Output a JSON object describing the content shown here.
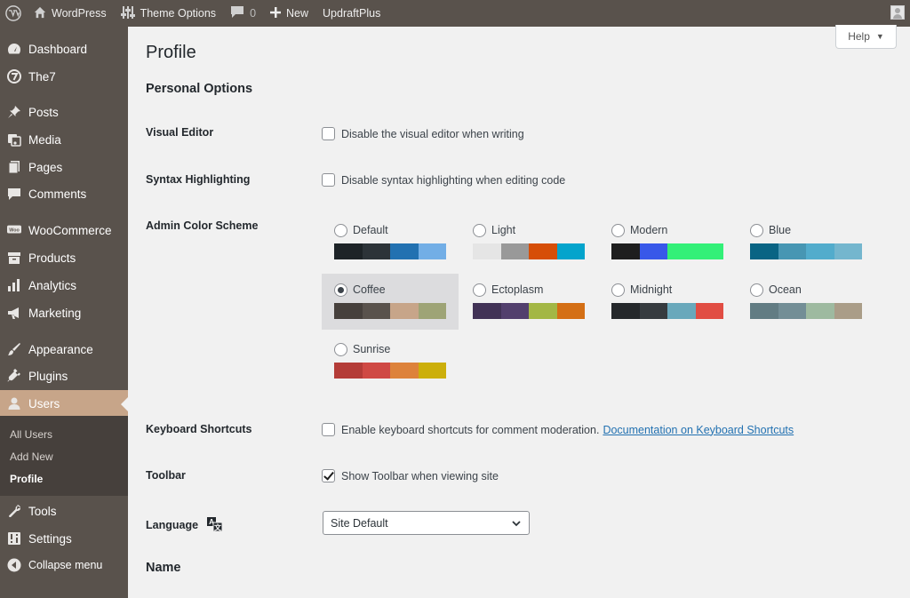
{
  "adminbar": {
    "site_name": "WordPress",
    "theme_options": "Theme Options",
    "comments_count": "0",
    "new_label": "New",
    "updraft": "UpdraftPlus"
  },
  "sidebar": {
    "items": [
      {
        "label": "Dashboard",
        "icon": "dashboard-icon"
      },
      {
        "label": "The7",
        "icon": "the7-icon"
      },
      {
        "label": "Posts",
        "icon": "pin-icon"
      },
      {
        "label": "Media",
        "icon": "media-icon"
      },
      {
        "label": "Pages",
        "icon": "pages-icon"
      },
      {
        "label": "Comments",
        "icon": "comment-icon"
      },
      {
        "label": "WooCommerce",
        "icon": "woo-icon"
      },
      {
        "label": "Products",
        "icon": "archive-icon"
      },
      {
        "label": "Analytics",
        "icon": "bar-chart-icon"
      },
      {
        "label": "Marketing",
        "icon": "megaphone-icon"
      },
      {
        "label": "Appearance",
        "icon": "brush-icon"
      },
      {
        "label": "Plugins",
        "icon": "plug-icon"
      },
      {
        "label": "Users",
        "icon": "user-icon"
      },
      {
        "label": "Tools",
        "icon": "wrench-icon"
      },
      {
        "label": "Settings",
        "icon": "settings-icon"
      },
      {
        "label": "Collapse menu",
        "icon": "collapse-icon"
      }
    ],
    "submenu": [
      "All Users",
      "Add New",
      "Profile"
    ]
  },
  "help_label": "Help",
  "page_title": "Profile",
  "personal_options": "Personal Options",
  "visual_editor": {
    "label": "Visual Editor",
    "option": "Disable the visual editor when writing"
  },
  "syntax": {
    "label": "Syntax Highlighting",
    "option": "Disable syntax highlighting when editing code"
  },
  "color_scheme": {
    "label": "Admin Color Scheme",
    "selected": "Coffee",
    "schemes": [
      {
        "name": "Default",
        "colors": [
          "#1d2327",
          "#2c3338",
          "#2271b1",
          "#72aee6"
        ]
      },
      {
        "name": "Light",
        "colors": [
          "#e5e5e5",
          "#999999",
          "#d64e07",
          "#04a4cc"
        ]
      },
      {
        "name": "Modern",
        "colors": [
          "#1e1e1e",
          "#3858e9",
          "#33f078",
          "#33f078"
        ]
      },
      {
        "name": "Blue",
        "colors": [
          "#096484",
          "#4796b3",
          "#52accc",
          "#74b6ce"
        ]
      },
      {
        "name": "Coffee",
        "colors": [
          "#46403c",
          "#59524c",
          "#c7a589",
          "#9ea476"
        ]
      },
      {
        "name": "Ectoplasm",
        "colors": [
          "#413256",
          "#523f6d",
          "#a3b745",
          "#d46f15"
        ]
      },
      {
        "name": "Midnight",
        "colors": [
          "#25282b",
          "#363b3f",
          "#69a8bb",
          "#e14d43"
        ]
      },
      {
        "name": "Ocean",
        "colors": [
          "#627c83",
          "#738e96",
          "#9ebaa0",
          "#aa9d88"
        ]
      },
      {
        "name": "Sunrise",
        "colors": [
          "#b43c38",
          "#cf4944",
          "#dd823b",
          "#ccaf0b"
        ]
      }
    ]
  },
  "keyboard": {
    "label": "Keyboard Shortcuts",
    "option": "Enable keyboard shortcuts for comment moderation.",
    "link": "Documentation on Keyboard Shortcuts"
  },
  "toolbar": {
    "label": "Toolbar",
    "option": "Show Toolbar when viewing site"
  },
  "language": {
    "label": "Language",
    "value": "Site Default"
  },
  "name_heading": "Name"
}
